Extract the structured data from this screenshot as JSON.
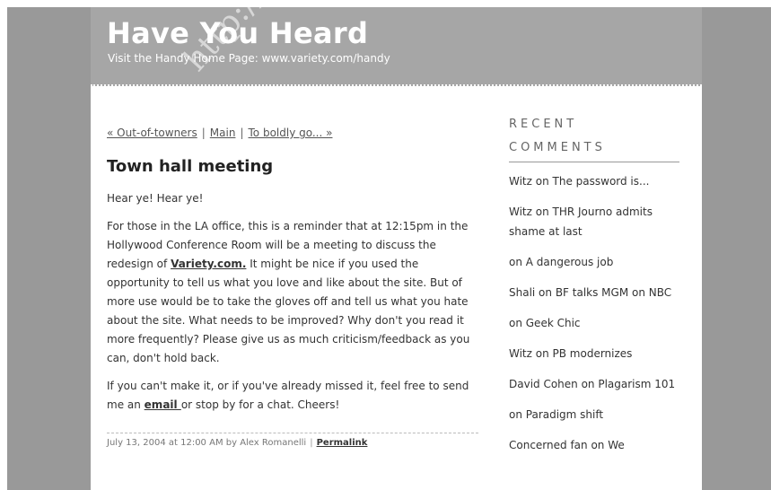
{
  "header": {
    "title": "Have You Heard",
    "subtitle": "Visit the Handy Home Page: www.variety.com/handy"
  },
  "watermark": "http://www.",
  "nav": {
    "prev": "« Out-of-towners",
    "main": "Main",
    "next": "To boldly go... »",
    "separator": "|"
  },
  "entry": {
    "title": "Town hall meeting",
    "p1": "Hear ye! Hear ye!",
    "p2_a": "For those in the LA office, this is a reminder that at 12:15pm in the Hollywood Conference Room will be a meeting to discuss the redesign of ",
    "p2_link": "Variety.com.",
    "p2_b": " It might be nice if you used the opportunity to tell us what you love and like about the site. But of more use would be to take the gloves off and tell us what you hate about the site. What needs to be improved? Why don't you read it more frequently? Please give us as much criticism/feedback as you can, don't hold back.",
    "p3_a": "If you can't make it, or if you've already missed it, feel free to send me an ",
    "p3_link": "email ",
    "p3_b": "or stop by for a chat. Cheers!",
    "footer_meta": "July 13, 2004 at 12:00 AM by Alex Romanelli",
    "footer_sep": "|",
    "permalink": "Permalink"
  },
  "sidebar": {
    "heading": "RECENT COMMENTS",
    "comments": [
      "Witz on The password is...",
      "Witz on THR Journo admits shame at last",
      "on A dangerous job",
      "Shali on BF talks MGM on NBC",
      "on Geek Chic",
      "Witz on PB modernizes",
      "David Cohen on Plagarism 101",
      "on Paradigm shift",
      "Concerned fan on We"
    ]
  }
}
